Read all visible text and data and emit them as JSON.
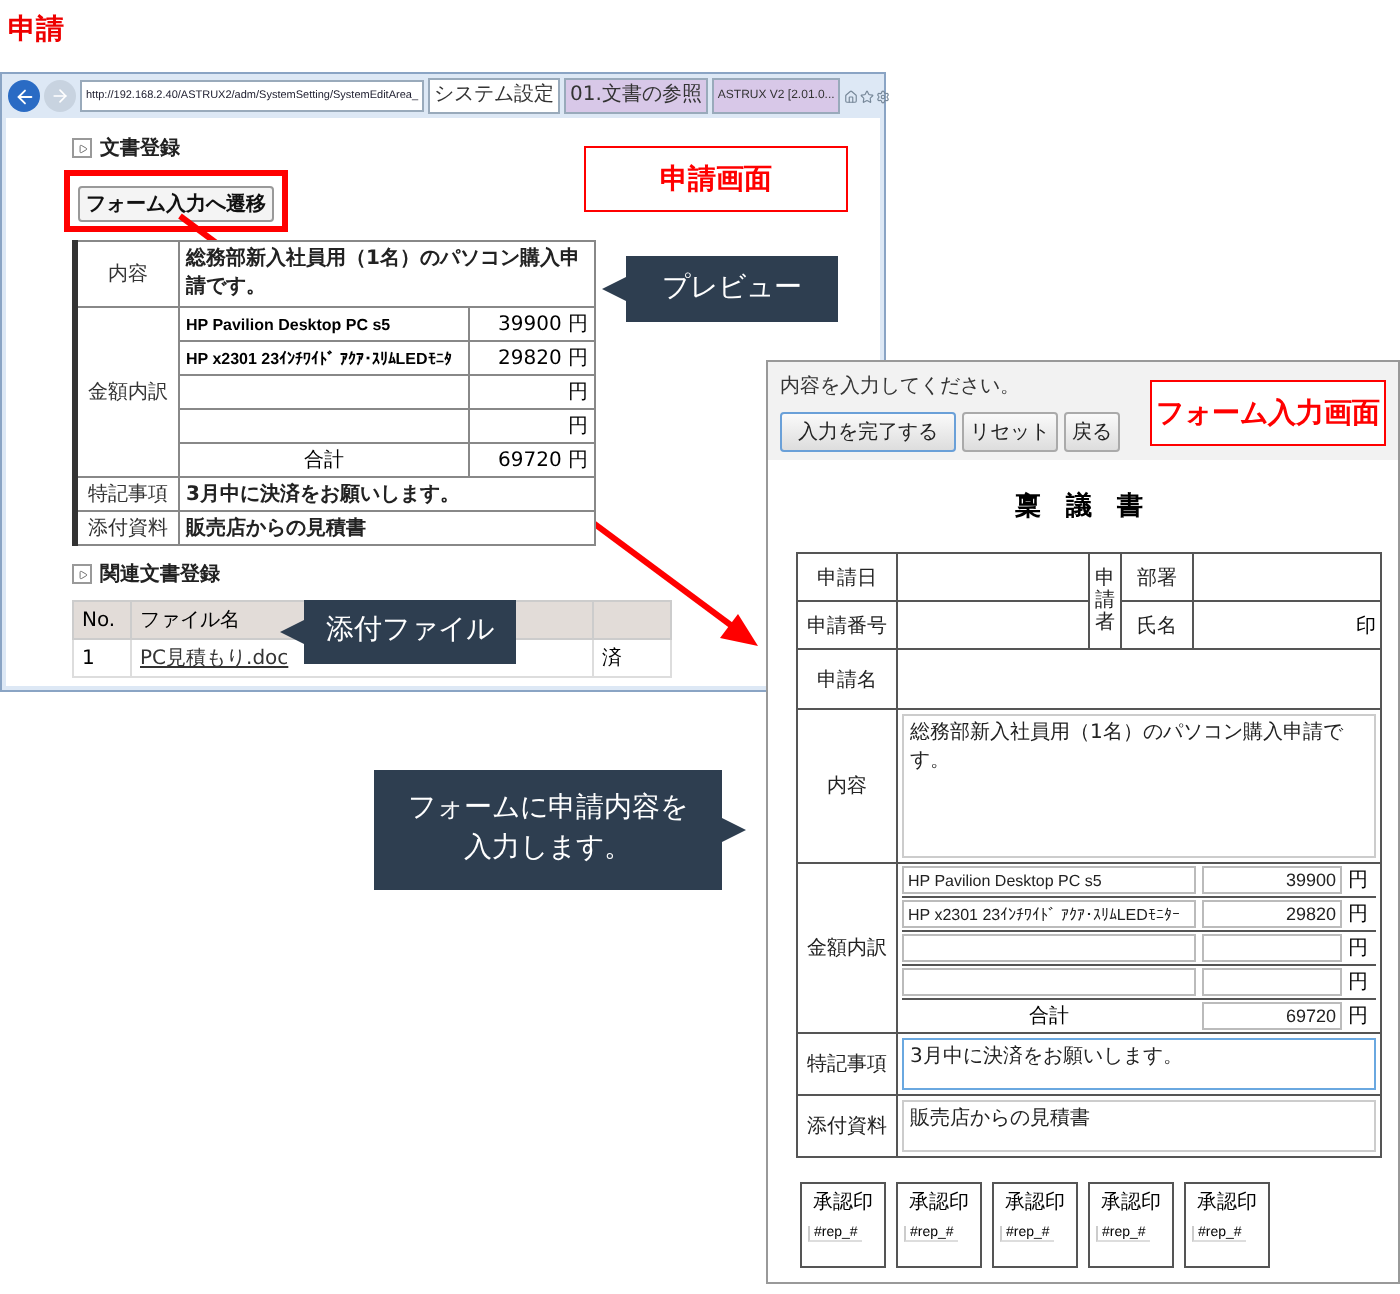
{
  "heading": "申請",
  "browser": {
    "url": "http://192.168.2.40/ASTRUX2/adm/SystemSetting/SystemEditArea_",
    "tabs": [
      {
        "label": "システム設定",
        "selected": true
      },
      {
        "label": "01.文書の参照",
        "selected": false
      },
      {
        "label": "ASTRUX V2 [2.01.0...",
        "selected": false
      }
    ],
    "section_1": "文書登録",
    "transition_button": "フォーム入力へ遷移",
    "preview": {
      "content_label": "内容",
      "content": "総務部新入社員用（1名）のパソコン購入申請です。",
      "amount_label": "金額内訳",
      "items": [
        {
          "name": "HP Pavilion Desktop PC s5",
          "amount": "39900",
          "unit": "円"
        },
        {
          "name": "HP x2301 23ｲﾝﾁﾜｲﾄﾞ ｱｸｱ･ｽﾘﾑLEDﾓﾆﾀ",
          "amount": "29820",
          "unit": "円"
        },
        {
          "unit": "円"
        },
        {
          "unit": "円"
        }
      ],
      "total_label": "合計",
      "total": "69720",
      "total_unit": "円",
      "notes_label": "特記事項",
      "notes": "3月中に決済をお願いします。",
      "attachments_label": "添付資料",
      "attachments": "販売店からの見積書"
    },
    "section_2": "関連文書登録",
    "files": {
      "columns": [
        "No.",
        "ファイル名"
      ],
      "rows": [
        {
          "no": "1",
          "name": "PC見積もり.doc",
          "status": "済"
        }
      ]
    }
  },
  "screen_label": "申請画面",
  "preview_callout": "プレビュー",
  "attachment_callout": "添付ファイル",
  "instruction_callout": [
    "フォームに申請内容を",
    "入力します。"
  ],
  "form": {
    "hint": "内容を入力してください。",
    "buttons": [
      {
        "label": "入力を完了する",
        "kind": "primary"
      },
      {
        "label": "リセット",
        "kind": "normal"
      },
      {
        "label": "戻る",
        "kind": "normal"
      }
    ],
    "screen_label": "フォーム入力画面",
    "title": "稟 議 書",
    "date_label": "申請日",
    "number_label": "申請番号",
    "applicant_label": "申請者",
    "dept_label": "部署",
    "name_label": "氏名",
    "seal": "印",
    "subject_label": "申請名",
    "content_label": "内容",
    "content": "総務部新入社員用（1名）のパソコン購入申請です。",
    "amount_label": "金額内訳",
    "items": [
      {
        "name": "HP Pavilion Desktop PC s5",
        "amount": "39900",
        "unit": "円"
      },
      {
        "name": "HP x2301 23ｲﾝﾁﾜｲﾄﾞ ｱｸｱ･ｽﾘﾑLEDﾓﾆﾀｰ",
        "amount": "29820",
        "unit": "円"
      },
      {
        "unit": "円"
      },
      {
        "unit": "円"
      }
    ],
    "total_label": "合計",
    "total": "69720",
    "total_unit": "円",
    "notes_label": "特記事項",
    "notes": "3月中に決済をお願いします。",
    "notes_focused": true,
    "attachments_label": "添付資料",
    "attachments": "販売店からの見積書",
    "approvals": [
      {
        "label": "承認印",
        "value": "#rep_#"
      },
      {
        "label": "承認印",
        "value": "#rep_#"
      },
      {
        "label": "承認印",
        "value": "#rep_#"
      },
      {
        "label": "承認印",
        "value": "#rep_#"
      },
      {
        "label": "承認印",
        "value": "#rep_#"
      }
    ]
  }
}
